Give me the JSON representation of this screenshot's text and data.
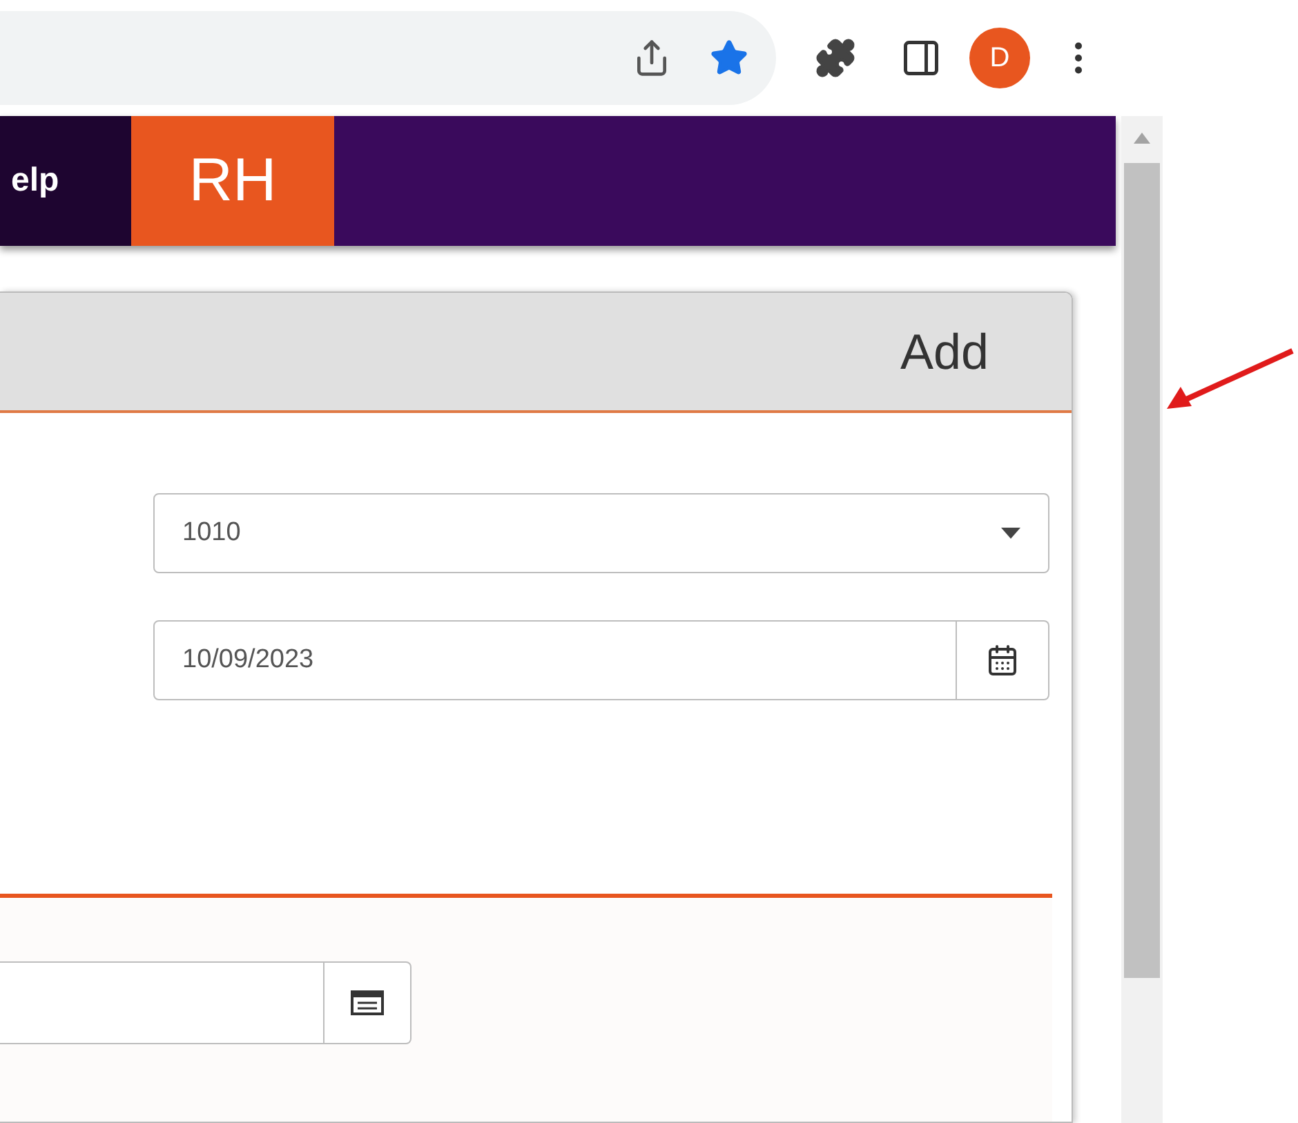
{
  "browser": {
    "profile_initial": "D",
    "bookmarked": true
  },
  "nav": {
    "items": [
      {
        "label": "elp",
        "selected": false
      },
      {
        "label": "RH",
        "selected": true
      }
    ]
  },
  "card": {
    "title": "Add",
    "fields": [
      {
        "kind": "select",
        "value": "1010"
      },
      {
        "kind": "date",
        "value": "10/09/2023"
      }
    ]
  },
  "lower_panel": {
    "field": {
      "kind": "lookup"
    }
  }
}
